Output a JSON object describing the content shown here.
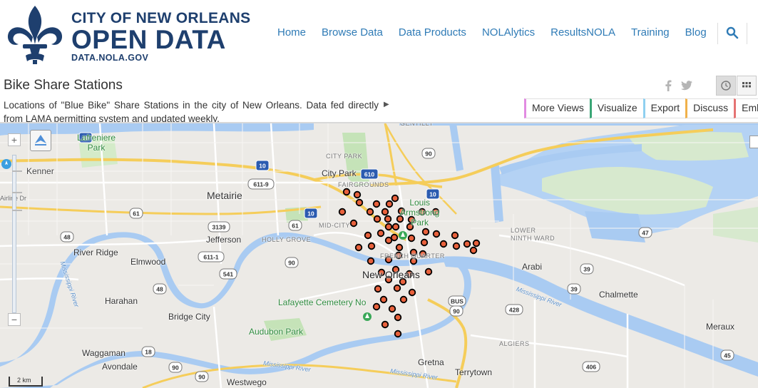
{
  "site": {
    "logo_line1": "CITY OF NEW ORLEANS",
    "logo_line2": "OPEN DATA",
    "logo_line3": "DATA.NOLA.GOV",
    "brand_color": "#1e3f6e",
    "nav_color": "#2f7bb6",
    "nav": [
      "Home",
      "Browse Data",
      "Data Products",
      "NOLAlytics",
      "ResultsNOLA",
      "Training",
      "Blog"
    ]
  },
  "dataset": {
    "title": "Bike Share Stations",
    "description": "Locations of \"Blue Bike\" Share Stations in the city of New Orleans. Data fed directly from LAMA permitting system and updated weekly.",
    "actions": [
      {
        "label": "More Views",
        "color": "#e28be2"
      },
      {
        "label": "Visualize",
        "color": "#3aa676"
      },
      {
        "label": "Export",
        "color": "#8fd0f0"
      },
      {
        "label": "Discuss",
        "color": "#f0b14a"
      },
      {
        "label": "Emb",
        "color": "#e57373"
      }
    ]
  },
  "map": {
    "scale_label": "2 km",
    "marker_color": "#e8613c",
    "city_labels": [
      {
        "text": "Lafreniere\nPark",
        "style": "park"
      },
      {
        "text": "Kenner",
        "style": "city"
      },
      {
        "text": "Metairie",
        "style": "big"
      },
      {
        "text": "City Park",
        "style": "city"
      },
      {
        "text": "CITY PARK",
        "style": "district"
      },
      {
        "text": "FAIRGROUNDS",
        "style": "district"
      },
      {
        "text": "GENTILLY",
        "style": "district"
      },
      {
        "text": "Jefferson",
        "style": "city"
      },
      {
        "text": "River Ridge",
        "style": "city"
      },
      {
        "text": "Elmwood",
        "style": "city"
      },
      {
        "text": "Harahan",
        "style": "city"
      },
      {
        "text": "HOLLY GROVE",
        "style": "district"
      },
      {
        "text": "MID-CITY",
        "style": "district"
      },
      {
        "text": "Louis\nArmstrong\nPark",
        "style": "park"
      },
      {
        "text": "FRENCH QUARTER",
        "style": "district"
      },
      {
        "text": "New Orleans",
        "style": "big"
      },
      {
        "text": "LOWER\nNINTH WARD",
        "style": "district"
      },
      {
        "text": "Arabi",
        "style": "city"
      },
      {
        "text": "Chalmette",
        "style": "city"
      },
      {
        "text": "Lafayette Cemetery No",
        "style": "park"
      },
      {
        "text": "Audubon Park",
        "style": "park"
      },
      {
        "text": "Bridge City",
        "style": "city"
      },
      {
        "text": "Waggaman",
        "style": "city"
      },
      {
        "text": "Avondale",
        "style": "city"
      },
      {
        "text": "Westwego",
        "style": "city"
      },
      {
        "text": "ALGIERS",
        "style": "district"
      },
      {
        "text": "Gretna",
        "style": "city"
      },
      {
        "text": "Terrytown",
        "style": "city"
      },
      {
        "text": "Meraux",
        "style": "city"
      },
      {
        "text": "Mississippi River",
        "style": "river"
      },
      {
        "text": "Mississippi River",
        "style": "river"
      },
      {
        "text": "Mississippi River",
        "style": "river"
      },
      {
        "text": "Mississippi River",
        "style": "river"
      },
      {
        "text": "Airline Dr",
        "style": "road"
      }
    ],
    "shields": [
      "10",
      "610",
      "10",
      "61",
      "3139",
      "611-9",
      "10",
      "61",
      "48",
      "611-1",
      "90",
      "541",
      "48",
      "90",
      "39",
      "39",
      "47",
      "428",
      "90",
      "BUS",
      "45",
      "18",
      "90",
      "90",
      "406",
      "10"
    ],
    "station_count": 58
  }
}
